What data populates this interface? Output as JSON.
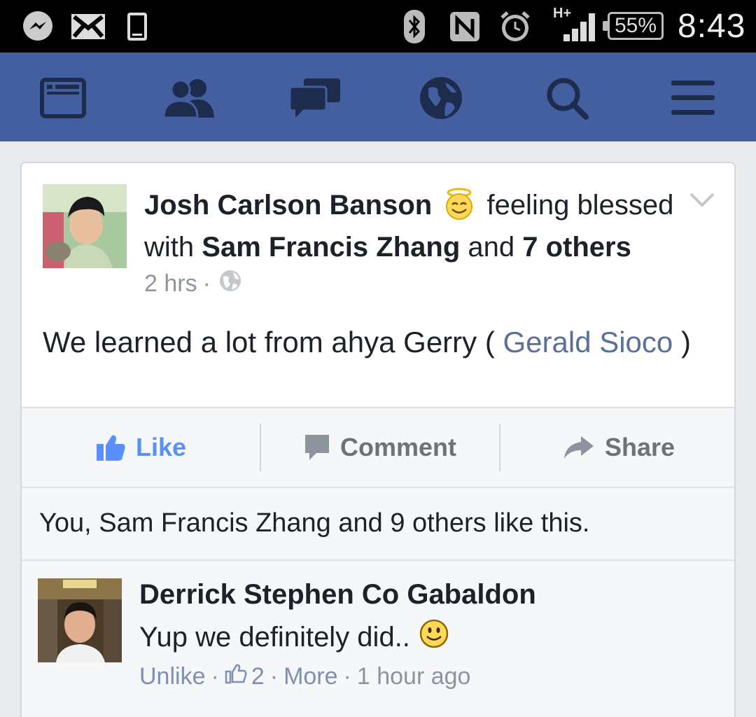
{
  "status_bar": {
    "battery": "55%",
    "time": "8:43",
    "network": "H+"
  },
  "nav": {
    "items": [
      "news-feed-icon",
      "friends-icon",
      "messages-icon",
      "notifications-globe-icon",
      "search-icon",
      "menu-icon"
    ]
  },
  "post": {
    "author": "Josh Carlson Banson",
    "feeling": "feeling blessed",
    "with_word": "with",
    "tagged": "Sam Francis Zhang",
    "and_word": "and",
    "others": "7 others",
    "time": "2 hrs",
    "meta_sep": "·",
    "text_before": "We learned a lot from ahya Gerry (",
    "mention": "Gerald Sioco",
    "text_after": ")"
  },
  "actions": {
    "like": "Like",
    "comment": "Comment",
    "share": "Share"
  },
  "likes_summary": "You, Sam Francis Zhang and 9 others like this.",
  "comment": {
    "author": "Derrick Stephen Co Gabaldon",
    "text": "Yup we definitely did..",
    "unlike": "Unlike",
    "like_count": "2",
    "more": "More",
    "time": "1 hour ago",
    "sep": "·"
  },
  "colors": {
    "nav_bg": "#435f9f",
    "like_blue": "#5890ff",
    "mention": "#5b7099"
  }
}
